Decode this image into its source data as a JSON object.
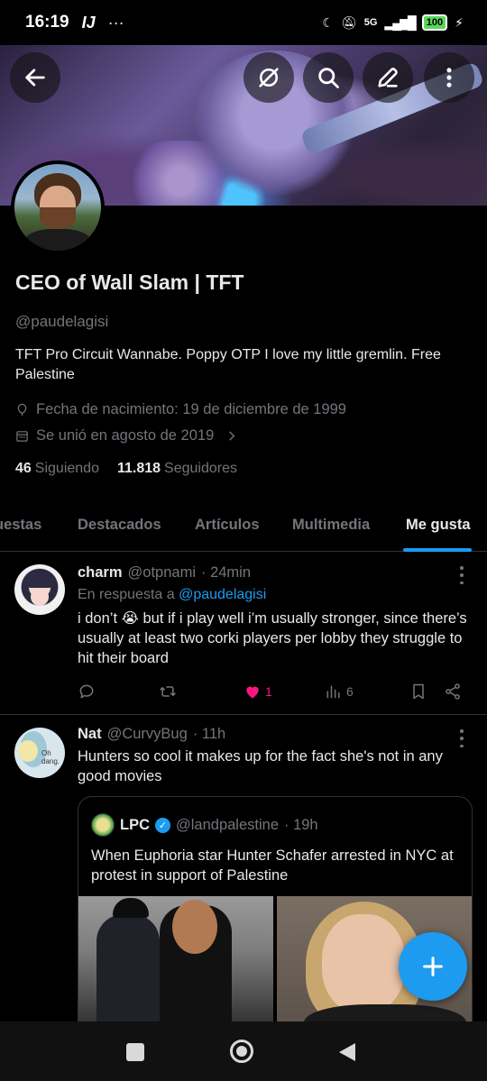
{
  "status_bar": {
    "time": "16:19",
    "network": "5G",
    "battery": "100"
  },
  "header_buttons": [
    "back-arrow-icon",
    "no-retweets-icon",
    "search-icon",
    "edit-icon",
    "more-vertical-icon"
  ],
  "profile": {
    "display_name": "CEO of Wall Slam | TFT",
    "handle": "@paudelagisi",
    "bio": "TFT Pro Circuit Wannabe. Poppy OTP I love my little gremlin. Free Palestine",
    "birthday": "Fecha de nacimiento: 19 de diciembre de 1999",
    "joined": "Se unió en agosto de 2019",
    "following_count": "46",
    "following_label": "Siguiendo",
    "followers_count": "11.818",
    "followers_label": "Seguidores"
  },
  "tabs": [
    {
      "label": "uestas"
    },
    {
      "label": "Destacados"
    },
    {
      "label": "Artículos"
    },
    {
      "label": "Multimedia"
    },
    {
      "label": "Me gusta",
      "active": true
    }
  ],
  "tweets": [
    {
      "name": "charm",
      "handle": "@otpnami",
      "time": "· 24min",
      "reply_prefix": "En respuesta a",
      "reply_handle": "@paudelagisi",
      "text": "i don’t 😭 but if i play well i’m usually stronger, since there’s usually at least two corki players per lobby they struggle to hit their board",
      "likes": "1",
      "views": "6"
    },
    {
      "name": "Nat",
      "handle": "@CurvyBug",
      "time": "· 11h",
      "text": "Hunters so cool it makes up for the fact she's not in any good movies",
      "quote": {
        "name": "LPC",
        "handle": "@landpalestine",
        "time": "· 19h",
        "text": "When Euphoria star Hunter Schafer arrested in NYC at protest in support of Palestine"
      }
    }
  ],
  "colors": {
    "accent": "#1d9bf0",
    "like": "#f91880",
    "muted": "#71767b",
    "text": "#e7e9ea",
    "border": "#2f3336"
  }
}
